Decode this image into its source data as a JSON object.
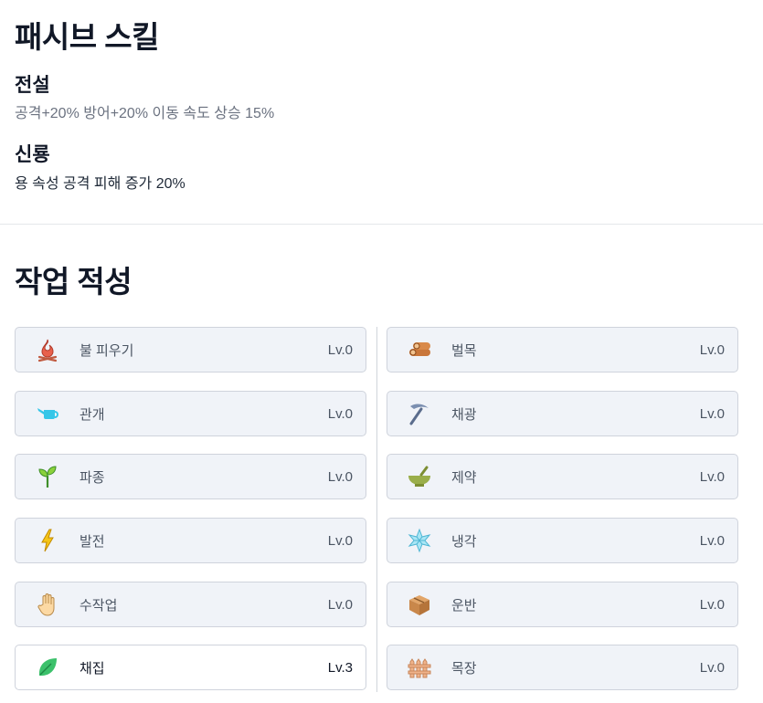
{
  "passive": {
    "title": "패시브 스킬",
    "skills": [
      {
        "name": "전설",
        "desc": "공격+20% 방어+20% 이동 속도 상승 15%",
        "desc_color": "#6b7280"
      },
      {
        "name": "신룡",
        "desc": "용 속성 공격 피해 증가 20%",
        "desc_color": "#1f2937"
      }
    ]
  },
  "work": {
    "title": "작업 적성",
    "left": [
      {
        "name": "불 피우기",
        "level": "Lv.0",
        "icon": "campfire-icon"
      },
      {
        "name": "관개",
        "level": "Lv.0",
        "icon": "watering-can-icon"
      },
      {
        "name": "파종",
        "level": "Lv.0",
        "icon": "sprout-icon"
      },
      {
        "name": "발전",
        "level": "Lv.0",
        "icon": "lightning-icon"
      },
      {
        "name": "수작업",
        "level": "Lv.0",
        "icon": "hand-icon"
      },
      {
        "name": "채집",
        "level": "Lv.3",
        "icon": "leaf-icon",
        "active": true
      }
    ],
    "right": [
      {
        "name": "벌목",
        "level": "Lv.0",
        "icon": "logs-icon"
      },
      {
        "name": "채광",
        "level": "Lv.0",
        "icon": "pickaxe-icon"
      },
      {
        "name": "제약",
        "level": "Lv.0",
        "icon": "mortar-icon"
      },
      {
        "name": "냉각",
        "level": "Lv.0",
        "icon": "snowflake-icon"
      },
      {
        "name": "운반",
        "level": "Lv.0",
        "icon": "box-icon"
      },
      {
        "name": "목장",
        "level": "Lv.0",
        "icon": "fence-icon"
      }
    ]
  }
}
